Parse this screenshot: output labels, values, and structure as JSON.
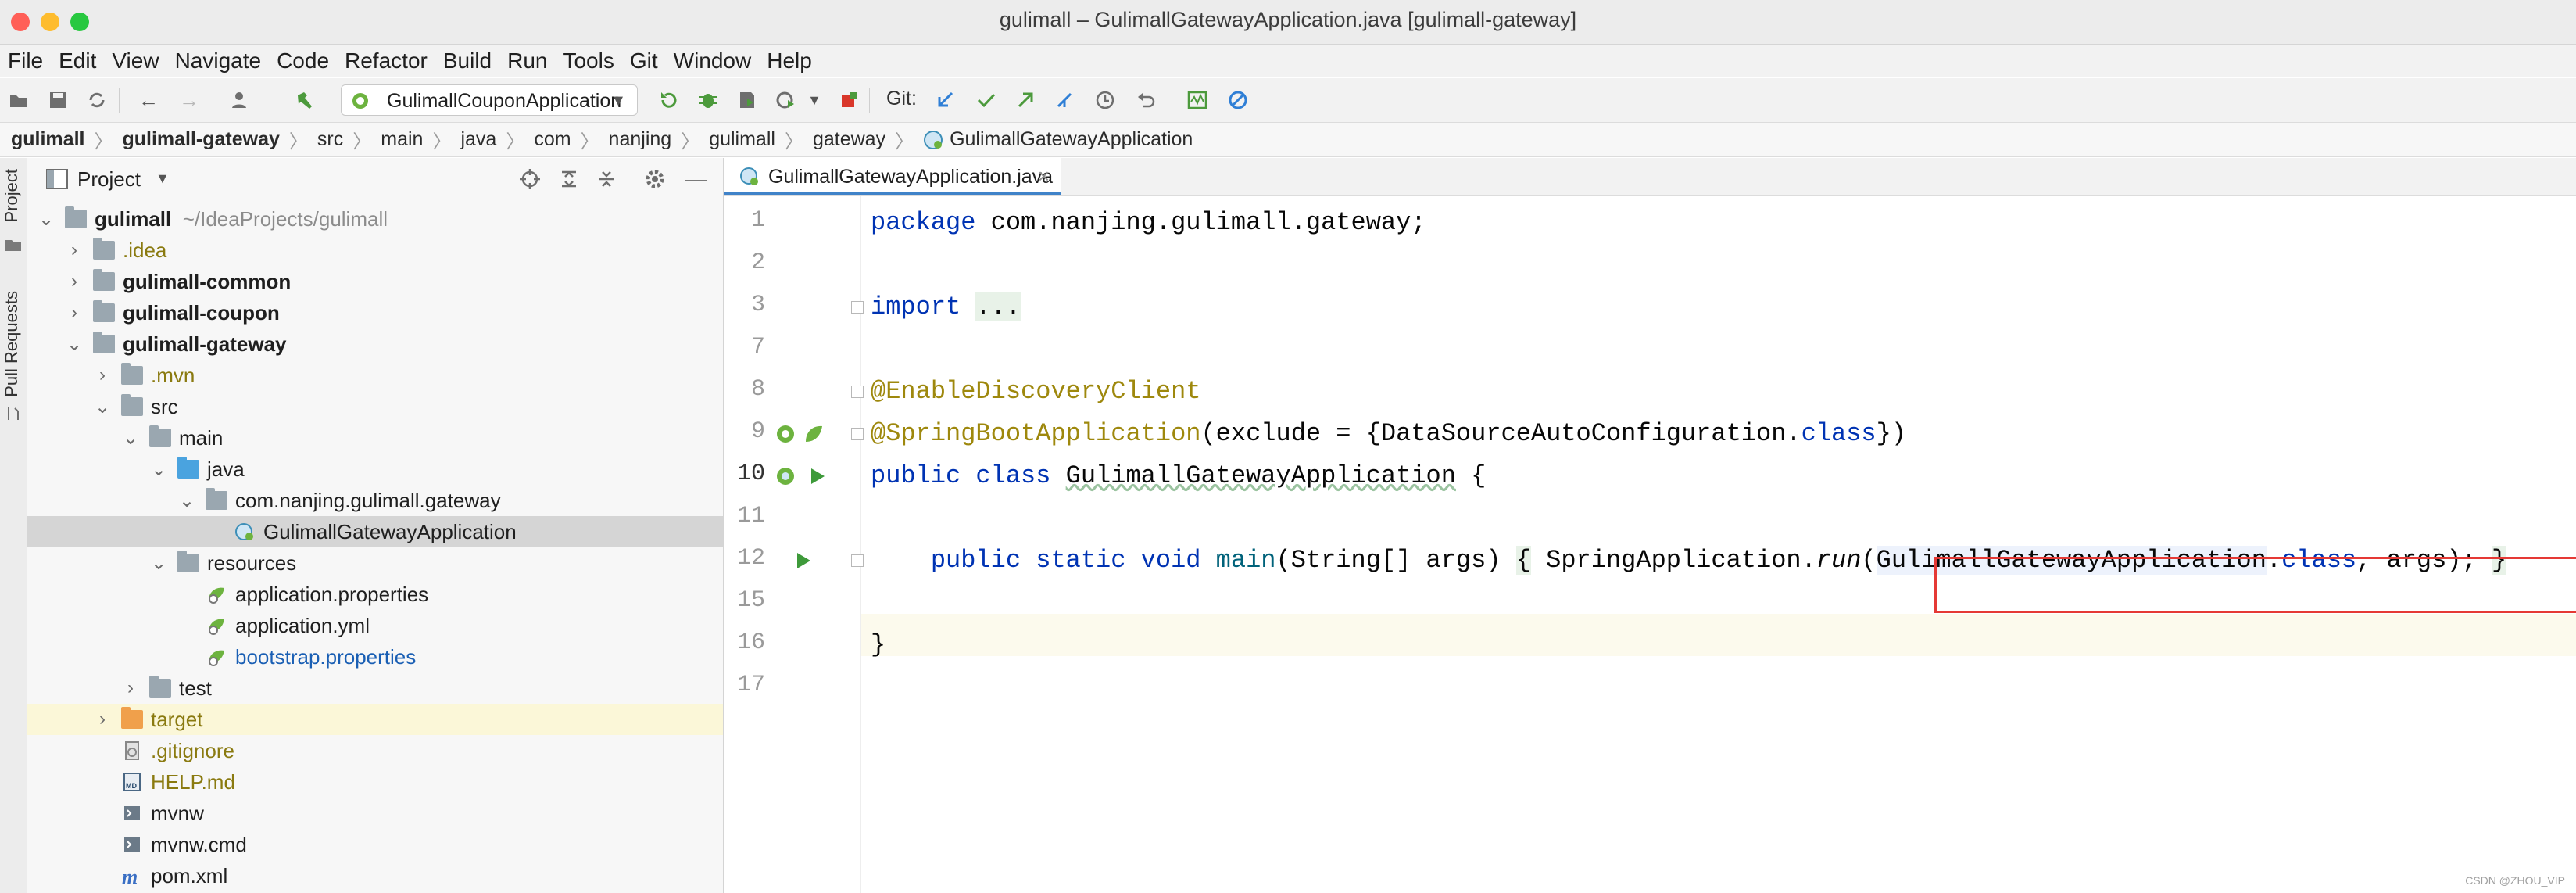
{
  "window": {
    "title": "gulimall – GulimallGatewayApplication.java [gulimall-gateway]",
    "traffic_colors": [
      "#ff5f57",
      "#febc2e",
      "#28c840"
    ]
  },
  "menu": [
    "File",
    "Edit",
    "View",
    "Navigate",
    "Code",
    "Refactor",
    "Build",
    "Run",
    "Tools",
    "Git",
    "Window",
    "Help"
  ],
  "toolbar": {
    "run_config": "GulimallCouponApplication",
    "git_label": "Git:"
  },
  "breadcrumb": [
    "gulimall",
    "gulimall-gateway",
    "src",
    "main",
    "java",
    "com",
    "nanjing",
    "gulimall",
    "gateway",
    "GulimallGatewayApplication"
  ],
  "left_strip": {
    "project_tab": "Project",
    "pull_requests_tab": "Pull Requests"
  },
  "project_panel": {
    "title": "Project",
    "tree": [
      {
        "label": "gulimall",
        "hint": "~/IdeaProjects/gulimall",
        "bold": true
      },
      {
        "label": ".idea"
      },
      {
        "label": "gulimall-common",
        "bold": true
      },
      {
        "label": "gulimall-coupon",
        "bold": true
      },
      {
        "label": "gulimall-gateway",
        "bold": true
      },
      {
        "label": ".mvn"
      },
      {
        "label": "src"
      },
      {
        "label": "main"
      },
      {
        "label": "java"
      },
      {
        "label": "com.nanjing.gulimall.gateway"
      },
      {
        "label": "GulimallGatewayApplication"
      },
      {
        "label": "resources"
      },
      {
        "label": "application.properties"
      },
      {
        "label": "application.yml"
      },
      {
        "label": "bootstrap.properties"
      },
      {
        "label": "test"
      },
      {
        "label": "target"
      },
      {
        "label": ".gitignore"
      },
      {
        "label": "HELP.md"
      },
      {
        "label": "mvnw"
      },
      {
        "label": "mvnw.cmd"
      },
      {
        "label": "pom.xml"
      }
    ]
  },
  "editor": {
    "tab_label": "GulimallGatewayApplication.java",
    "line_numbers": [
      "1",
      "2",
      "3",
      "7",
      "8",
      "9",
      "10",
      "11",
      "12",
      "15",
      "16",
      "17"
    ],
    "code": {
      "l1_kw": "package",
      "l1_rest": " com.nanjing.gulimall.gateway;",
      "l3_kw": "import",
      "l3_fold": "...",
      "l8_ann": "@EnableDiscoveryClient",
      "l9_at": "@",
      "l9_ann": "SpringBootApplication",
      "l9_args_a": "(exclude = {DataSourceAutoConfiguration.",
      "l9_args_kw": "class",
      "l9_args_b": "})",
      "l10_kw": "public class ",
      "l10_name": "GulimallGatewayApplication",
      "l10_rest": " {",
      "l12_kw1": "public static void ",
      "l12_main": "main",
      "l12_sig": "(String[] args) ",
      "l12_fold_open": "{",
      "l12_body_a": " SpringApplication.",
      "l12_run": "run",
      "l12_paren": "(",
      "l12_cls": "GulimallGatewayApplication",
      "l12_dot": ".",
      "l12_class_kw": "class",
      "l12_args": ", args); ",
      "l12_fold_close": "}",
      "l16": "}"
    }
  },
  "watermark": "CSDN @ZHOU_VIP"
}
